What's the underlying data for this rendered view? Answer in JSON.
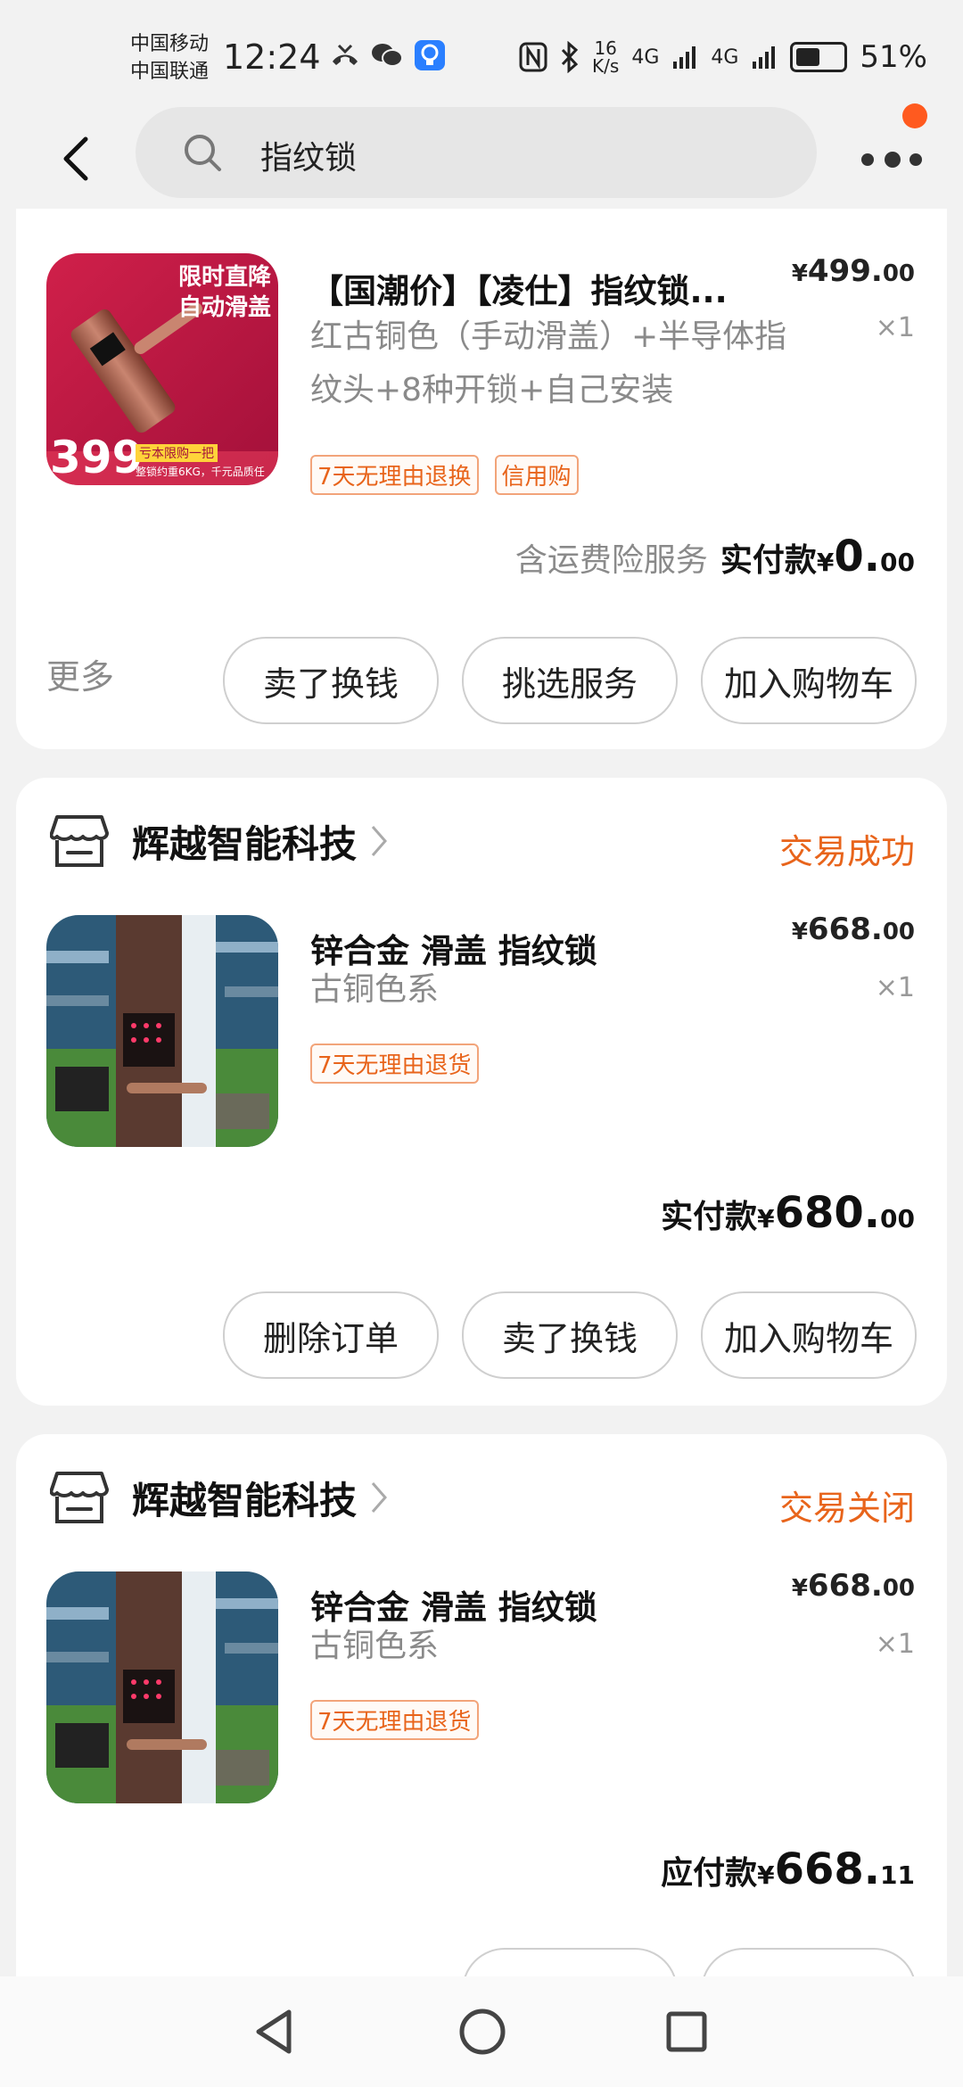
{
  "status_bar": {
    "carrier1": "中国移动",
    "carrier2": "中国联通",
    "time": "12:24",
    "net_speed_value": "16",
    "net_speed_unit": "K/s",
    "signal1": "4G",
    "signal2": "4G",
    "battery": "51%"
  },
  "header": {
    "search_text": "指纹锁"
  },
  "orders": [
    {
      "product_title": "【国潮价】【凌仕】指纹锁...",
      "sku": "红古铜色（手动滑盖）+半导体指纹头+8种开锁+自己安装",
      "tags": [
        "7天无理由退换",
        "信用购"
      ],
      "price_yen": "¥",
      "price_int": "499.",
      "price_cents": "00",
      "qty": "×1",
      "thumb_banner": "限时直降\n自动滑盖",
      "thumb_price": "399",
      "thumb_strip": "亏本限购一把",
      "thumb_note": "整锁约重6KG，千元品质任",
      "service_note": "含运费险服务",
      "paid_label": "实付款",
      "paid_yen": "¥",
      "paid_int": "0.",
      "paid_cents": "00",
      "more_label": "更多",
      "buttons": [
        "卖了换钱",
        "挑选服务",
        "加入购物车"
      ]
    },
    {
      "shop_name": "辉越智能科技",
      "status": "交易成功",
      "product_title": "锌合金  滑盖  指纹锁",
      "sku": "古铜色系",
      "tags": [
        "7天无理由退货"
      ],
      "price_yen": "¥",
      "price_int": "668.",
      "price_cents": "00",
      "qty": "×1",
      "paid_label": "实付款",
      "paid_yen": "¥",
      "paid_int": "680.",
      "paid_cents": "00",
      "buttons": [
        "删除订单",
        "卖了换钱",
        "加入购物车"
      ]
    },
    {
      "shop_name": "辉越智能科技",
      "status": "交易关闭",
      "product_title": "锌合金  滑盖  指纹锁",
      "sku": "古铜色系",
      "tags": [
        "7天无理由退货"
      ],
      "price_yen": "¥",
      "price_int": "668.",
      "price_cents": "00",
      "qty": "×1",
      "paid_label": "应付款",
      "paid_yen": "¥",
      "paid_int": "668.",
      "paid_cents": "11"
    }
  ],
  "colors": {
    "accent": "#e8641b",
    "notify_dot": "#ff5a1f",
    "background": "#f2f2f2"
  },
  "nav": {
    "icons": [
      "back-triangle-icon",
      "home-circle-icon",
      "recents-square-icon"
    ]
  }
}
